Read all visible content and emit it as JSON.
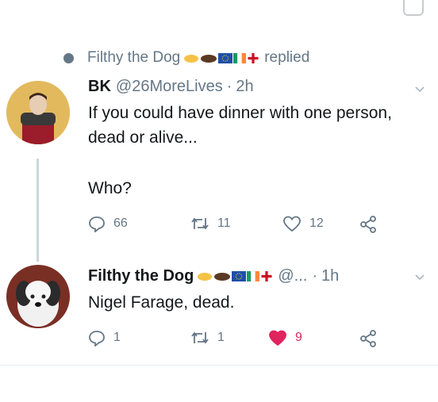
{
  "reply_header": {
    "user_name": "Filthy the Dog",
    "action_text": "replied"
  },
  "original_tweet": {
    "display_name": "BK",
    "handle": "@26MoreLives",
    "separator": "·",
    "time": "2h",
    "text_line1": "If you could have dinner with one person,",
    "text_line2": "dead or alive...",
    "text_line3": "Who?",
    "reply_count": "66",
    "retweet_count": "11",
    "like_count": "12"
  },
  "reply_tweet": {
    "display_name": "Filthy the Dog",
    "handle": "@...",
    "separator": "·",
    "time": "1h",
    "text": "Nigel Farage, dead.",
    "reply_count": "1",
    "retweet_count": "1",
    "like_count": "9",
    "like_color": "#e0245e"
  },
  "icons": [
    "comment-icon",
    "retweet-icon",
    "like-icon",
    "share-icon",
    "chevron-down-icon",
    "avatar"
  ],
  "colors": {
    "muted": "#657786",
    "line": "#ccd6dd"
  }
}
